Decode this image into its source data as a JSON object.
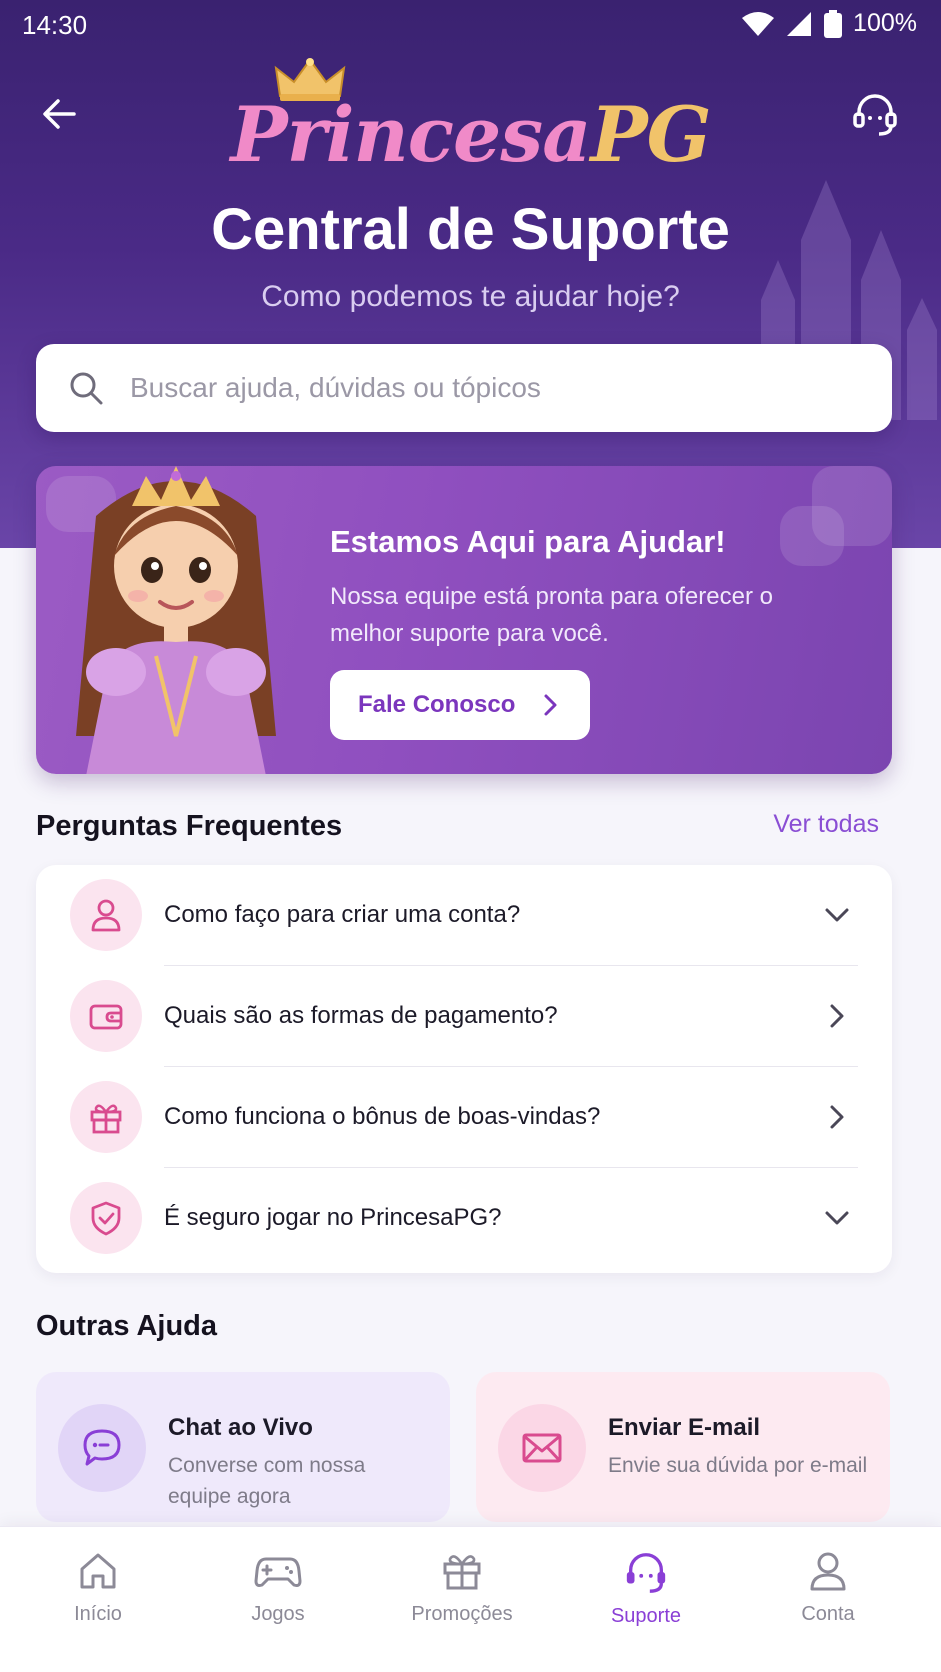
{
  "status_bar": {
    "time": "14:30",
    "battery": "100%"
  },
  "header": {
    "logo_part1": "Princesa",
    "logo_part2": "PG",
    "title": "Central de Suporte",
    "subtitle": "Como podemos te ajudar hoje?",
    "back_icon": "arrow-left-icon",
    "support_icon": "headset-icon"
  },
  "search": {
    "placeholder": "Buscar ajuda, dúvidas ou tópicos",
    "value": ""
  },
  "banner": {
    "title": "Estamos Aqui para Ajudar!",
    "text": "Nossa equipe está pronta para oferecer o melhor suporte para você.",
    "button_label": "Fale Conosco"
  },
  "faq": {
    "title": "Perguntas Frequentes",
    "see_all": "Ver todas",
    "items": [
      {
        "label": "Como faço para criar uma conta?",
        "icon": "user-icon",
        "chevron": "down"
      },
      {
        "label": "Quais são as formas de pagamento?",
        "icon": "wallet-icon",
        "chevron": "right"
      },
      {
        "label": "Como funciona o bônus de boas-vindas?",
        "icon": "gift-icon",
        "chevron": "right"
      },
      {
        "label": "É seguro jogar no PrincesaPG?",
        "icon": "shield-check-icon",
        "chevron": "down"
      }
    ]
  },
  "other_help": {
    "title": "Outras Ajuda",
    "cards": [
      {
        "title": "Chat ao Vivo",
        "desc": "Converse com nossa equipe agora",
        "icon": "chat-bubble-icon"
      },
      {
        "title": "Enviar E-mail",
        "desc": "Envie sua dúvida por e-mail",
        "icon": "envelope-icon"
      }
    ]
  },
  "bottom_nav": {
    "items": [
      {
        "label": "Início",
        "icon": "home-icon"
      },
      {
        "label": "Jogos",
        "icon": "gamepad-icon"
      },
      {
        "label": "Promoções",
        "icon": "gift-icon"
      },
      {
        "label": "Suporte",
        "icon": "headset-icon",
        "active": true
      },
      {
        "label": "Conta",
        "icon": "user-icon"
      }
    ]
  },
  "colors": {
    "header_bg": "#3a2270",
    "accent": "#8a3fd6",
    "banner_bg": "#9b5bc4",
    "faq_icon_bg": "#fbe4ef",
    "faq_icon": "#d94b8f",
    "logo_pink": "#f08ac8",
    "logo_gold": "#f1c36a"
  }
}
